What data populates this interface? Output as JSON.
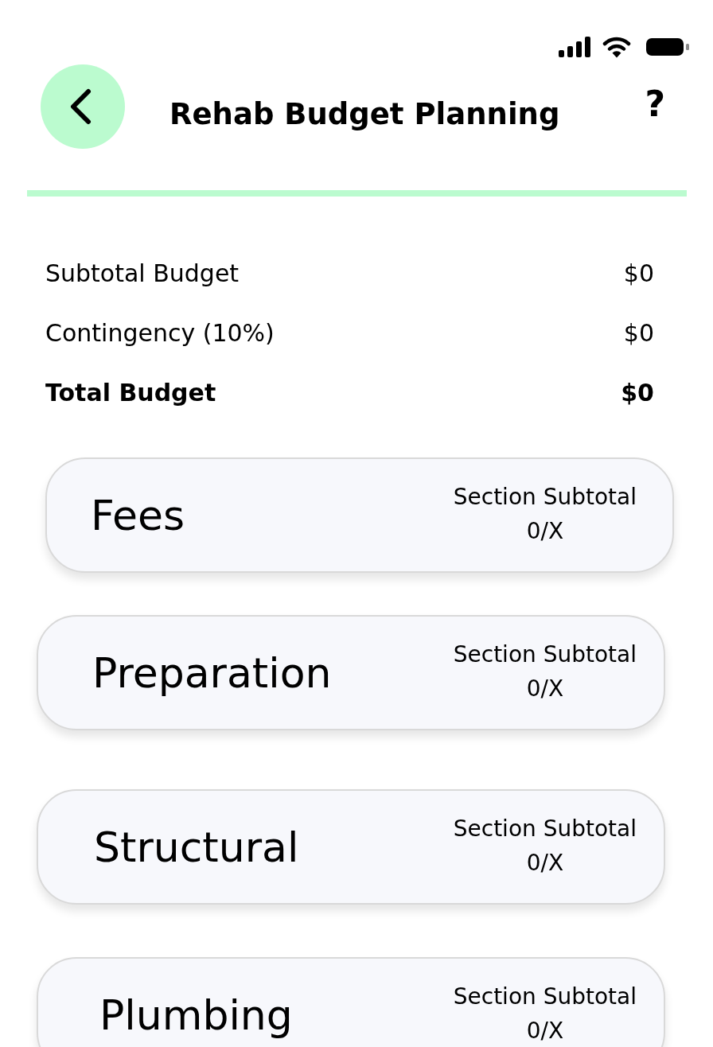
{
  "header": {
    "title": "Rehab Budget Planning",
    "help": "?"
  },
  "summary": [
    {
      "kind": "normal",
      "label": "Subtotal Budget",
      "value": "$0"
    },
    {
      "kind": "normal",
      "label": "Contingency (10%)",
      "value": "$0"
    },
    {
      "kind": "total",
      "label": "Total Budget",
      "value": "$0"
    }
  ],
  "sections": [
    {
      "title": "Fees",
      "subtotal_label": "Section Subtotal",
      "subtotal_value": "0/X"
    },
    {
      "title": "Preparation",
      "subtotal_label": "Section Subtotal",
      "subtotal_value": "0/X"
    },
    {
      "title": "Structural",
      "subtotal_label": "Section Subtotal",
      "subtotal_value": "0/X"
    },
    {
      "title": "Plumbing",
      "subtotal_label": "Section Subtotal",
      "subtotal_value": "0/X"
    }
  ]
}
